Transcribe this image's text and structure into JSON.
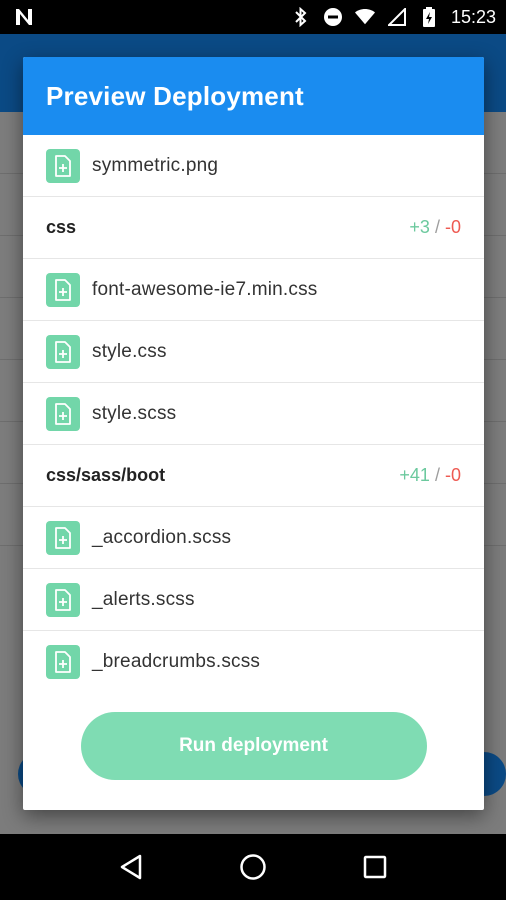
{
  "status_bar": {
    "time": "15:23",
    "icons": [
      "n-logo-icon",
      "bluetooth-icon",
      "do-not-disturb-icon",
      "wifi-icon",
      "no-sim-icon",
      "battery-charging-icon"
    ]
  },
  "dialog": {
    "title": "Preview Deployment",
    "rows": [
      {
        "kind": "file",
        "name": "symmetric.png",
        "icon": "file-add-icon"
      },
      {
        "kind": "group",
        "name": "css",
        "added": "+3",
        "sep": "/",
        "removed": "-0"
      },
      {
        "kind": "file",
        "name": "font-awesome-ie7.min.css",
        "icon": "file-add-icon"
      },
      {
        "kind": "file",
        "name": "style.css",
        "icon": "file-add-icon"
      },
      {
        "kind": "file",
        "name": "style.scss",
        "icon": "file-add-icon"
      },
      {
        "kind": "group",
        "name": "css/sass/boot",
        "added": "+41",
        "sep": "/",
        "removed": "-0"
      },
      {
        "kind": "file",
        "name": "_accordion.scss",
        "icon": "file-add-icon"
      },
      {
        "kind": "file",
        "name": "_alerts.scss",
        "icon": "file-add-icon"
      },
      {
        "kind": "file",
        "name": "_breadcrumbs.scss",
        "icon": "file-add-icon"
      }
    ],
    "run_button_label": "Run deployment"
  },
  "colors": {
    "header": "#1a8cf0",
    "file_icon": "#72d6a9",
    "added": "#6cc99e",
    "removed": "#ee5a52",
    "run_button": "#7fdcb3"
  },
  "nav_bar": {
    "buttons": [
      "back-icon",
      "home-icon",
      "recents-icon"
    ]
  }
}
